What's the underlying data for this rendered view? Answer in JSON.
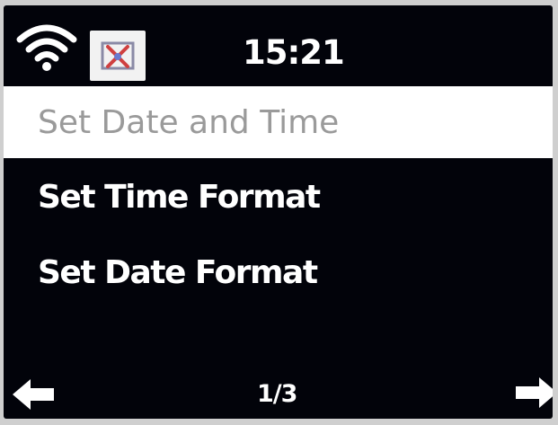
{
  "status_bar": {
    "wifi_icon": "wifi-icon",
    "network_status_icon": "no-network-icon",
    "time": "15:21"
  },
  "menu": {
    "items": [
      {
        "label": "Set Date and Time",
        "selected": true
      },
      {
        "label": "Set Time Format",
        "selected": false
      },
      {
        "label": "Set Date Format",
        "selected": false
      }
    ]
  },
  "footer": {
    "page": "1/3",
    "prev_icon": "arrow-left-icon",
    "next_icon": "arrow-right-icon"
  },
  "colors": {
    "screen_background": "#02030a",
    "selected_background": "#ffffff",
    "selected_text": "#9a9a9a",
    "text": "#ffffff"
  }
}
